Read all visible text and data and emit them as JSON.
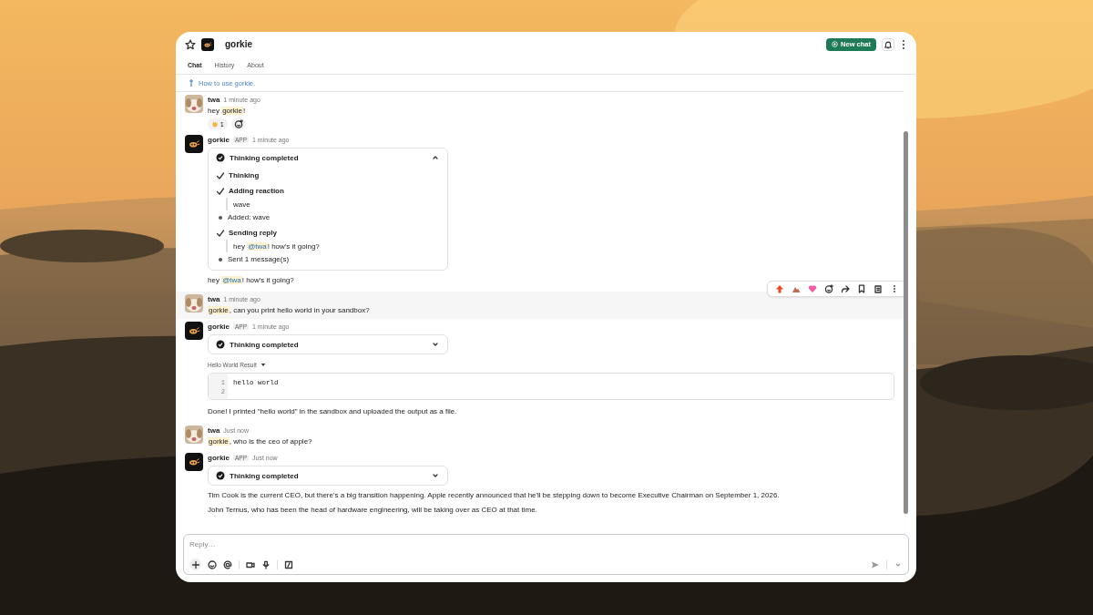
{
  "window": {
    "title": "gorkie"
  },
  "new_chat": "New chat",
  "tabs": [
    {
      "label": "Chat",
      "selected": true
    },
    {
      "label": "History",
      "selected": false
    },
    {
      "label": "About",
      "selected": false
    }
  ],
  "pinned_link": "How to use gorkie.",
  "messages": [
    {
      "kind": "user",
      "author": "twa",
      "time": "1 minute ago",
      "hovered": false,
      "text": [
        {
          "text": "hey "
        },
        {
          "text": "gorkie",
          "kind": "mention_app"
        },
        {
          "text": "!"
        }
      ],
      "reactions": [
        {
          "count": "1"
        }
      ]
    },
    {
      "kind": "bot",
      "author": "gorkie",
      "badge": "APP",
      "time": "1 minute ago",
      "thinking": {
        "title": "Thinking completed",
        "expanded": true,
        "steps": [
          {
            "kind": "step",
            "text": [
              {
                "text": "Thinking"
              }
            ]
          },
          {
            "kind": "step",
            "text": [
              {
                "text": "Adding reaction"
              }
            ]
          },
          {
            "kind": "detail",
            "text": [
              {
                "text": "wave"
              }
            ]
          },
          {
            "kind": "result",
            "text": [
              {
                "text": "Added: wave"
              }
            ]
          },
          {
            "kind": "step",
            "text": [
              {
                "text": "Sending reply"
              }
            ]
          },
          {
            "kind": "detail",
            "text": [
              {
                "text": "hey "
              },
              {
                "text": "@twa",
                "kind": "mention_user"
              },
              {
                "text": "! how's it going?"
              }
            ]
          },
          {
            "kind": "result",
            "text": [
              {
                "text": "Sent 1 message(s)"
              }
            ]
          }
        ]
      },
      "paragraphs": [
        [
          {
            "text": "hey "
          },
          {
            "text": "@twa",
            "kind": "mention_user"
          },
          {
            "text": "! how's it going?"
          }
        ]
      ]
    },
    {
      "kind": "user",
      "author": "twa",
      "time": "1 minute ago",
      "hovered": true,
      "text": [
        {
          "text": "gorkie",
          "kind": "mention_app"
        },
        {
          "text": ", can you print hello world in your sandbox?"
        }
      ]
    },
    {
      "kind": "bot",
      "author": "gorkie",
      "badge": "APP",
      "time": "1 minute ago",
      "thinking": {
        "title": "Thinking completed",
        "expanded": false
      },
      "file": {
        "title": "Hello World Result",
        "lines": [
          {
            "number": "1",
            "text": "hello world"
          },
          {
            "number": "2"
          }
        ]
      },
      "paragraphs": [
        [
          {
            "text": "Done! I printed \"hello world\" in the sandbox and uploaded the output as a file."
          }
        ]
      ]
    },
    {
      "kind": "user",
      "author": "twa",
      "time": "Just now",
      "hovered": false,
      "text": [
        {
          "text": "gorkie",
          "kind": "mention_app"
        },
        {
          "text": ", who is the ceo of apple?"
        }
      ]
    },
    {
      "kind": "bot",
      "author": "gorkie",
      "badge": "APP",
      "time": "Just now",
      "thinking": {
        "title": "Thinking completed",
        "expanded": false
      },
      "paragraphs": [
        [
          {
            "text": "Tim Cook is the current CEO, but there's a big transition happening. Apple recently announced that he'll be stepping down to become Executive Chairman on September 1, 2026."
          }
        ],
        [
          {
            "text": "John Ternus, who has been the head of hardware engineering, will be taking over as CEO at that time."
          }
        ]
      ]
    }
  ],
  "composer": {
    "placeholder": "Reply…"
  }
}
